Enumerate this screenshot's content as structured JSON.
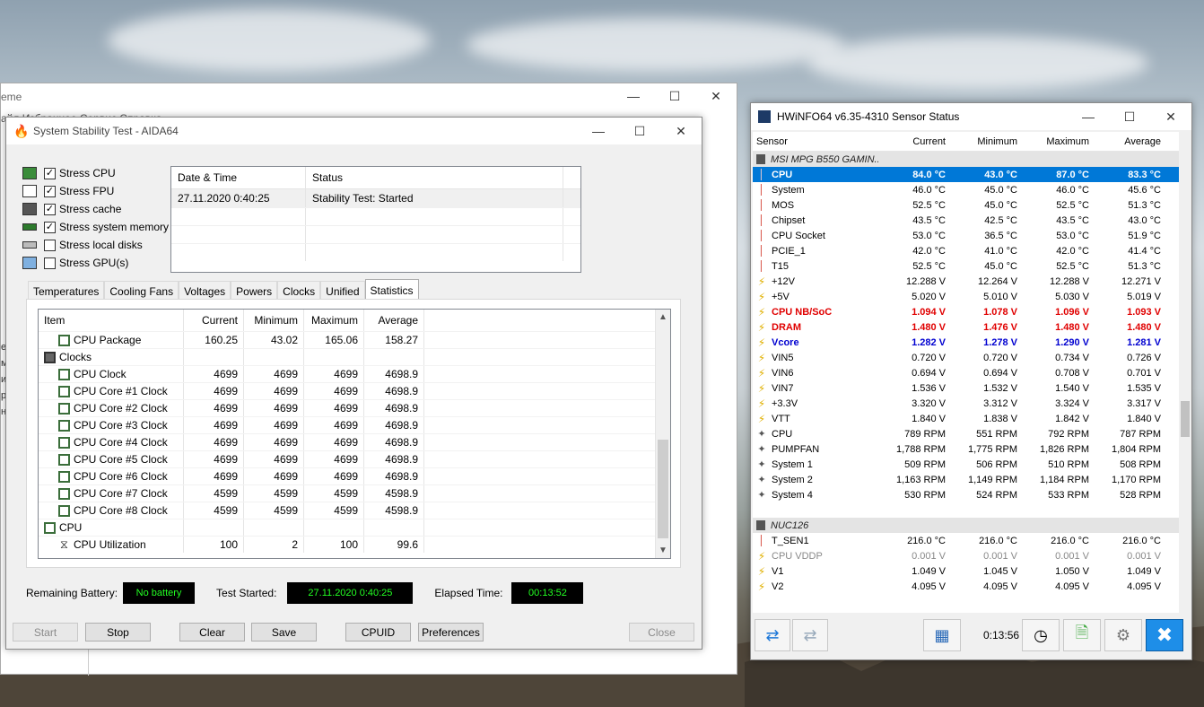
{
  "bg_window": {
    "title": "eme",
    "menu": "айл  Избранное  Сервис  Справка",
    "left_glyphs": [
      "е",
      "м",
      "и",
      "р",
      "н"
    ]
  },
  "aida": {
    "title": "System Stability Test - AIDA64",
    "stress": [
      {
        "label": "Stress CPU",
        "checked": true,
        "icon": "cpu-icon"
      },
      {
        "label": "Stress FPU",
        "checked": true,
        "icon": "fpu-icon"
      },
      {
        "label": "Stress cache",
        "checked": true,
        "icon": "cache-icon"
      },
      {
        "label": "Stress system memory",
        "checked": true,
        "icon": "memory-icon"
      },
      {
        "label": "Stress local disks",
        "checked": false,
        "icon": "disk-icon"
      },
      {
        "label": "Stress GPU(s)",
        "checked": false,
        "icon": "gpu-icon"
      }
    ],
    "status": {
      "headers": [
        "Date & Time",
        "Status"
      ],
      "rows": [
        [
          "27.11.2020 0:40:25",
          "Stability Test: Started"
        ]
      ]
    },
    "tabs": [
      "Temperatures",
      "Cooling Fans",
      "Voltages",
      "Powers",
      "Clocks",
      "Unified",
      "Statistics"
    ],
    "active_tab": "Statistics",
    "stats_headers": [
      "Item",
      "Current",
      "Minimum",
      "Maximum",
      "Average"
    ],
    "stats_rows": [
      {
        "name": "CPU Package",
        "level": 1,
        "icon": "chip",
        "cur": "160.25",
        "min": "43.02",
        "max": "165.06",
        "avg": "158.27"
      },
      {
        "name": "Clocks",
        "level": 0,
        "icon": "dark",
        "cur": "",
        "min": "",
        "max": "",
        "avg": ""
      },
      {
        "name": "CPU Clock",
        "level": 1,
        "icon": "chip",
        "cur": "4699",
        "min": "4699",
        "max": "4699",
        "avg": "4698.9"
      },
      {
        "name": "CPU Core #1 Clock",
        "level": 1,
        "icon": "chip",
        "cur": "4699",
        "min": "4699",
        "max": "4699",
        "avg": "4698.9"
      },
      {
        "name": "CPU Core #2 Clock",
        "level": 1,
        "icon": "chip",
        "cur": "4699",
        "min": "4699",
        "max": "4699",
        "avg": "4698.9"
      },
      {
        "name": "CPU Core #3 Clock",
        "level": 1,
        "icon": "chip",
        "cur": "4699",
        "min": "4699",
        "max": "4699",
        "avg": "4698.9"
      },
      {
        "name": "CPU Core #4 Clock",
        "level": 1,
        "icon": "chip",
        "cur": "4699",
        "min": "4699",
        "max": "4699",
        "avg": "4698.9"
      },
      {
        "name": "CPU Core #5 Clock",
        "level": 1,
        "icon": "chip",
        "cur": "4699",
        "min": "4699",
        "max": "4699",
        "avg": "4698.9"
      },
      {
        "name": "CPU Core #6 Clock",
        "level": 1,
        "icon": "chip",
        "cur": "4699",
        "min": "4699",
        "max": "4699",
        "avg": "4698.9"
      },
      {
        "name": "CPU Core #7 Clock",
        "level": 1,
        "icon": "chip",
        "cur": "4599",
        "min": "4599",
        "max": "4599",
        "avg": "4598.9"
      },
      {
        "name": "CPU Core #8 Clock",
        "level": 1,
        "icon": "chip",
        "cur": "4599",
        "min": "4599",
        "max": "4599",
        "avg": "4598.9"
      },
      {
        "name": "CPU",
        "level": 0,
        "icon": "chip",
        "cur": "",
        "min": "",
        "max": "",
        "avg": ""
      },
      {
        "name": "CPU Utilization",
        "level": 1,
        "icon": "hourglass",
        "cur": "100",
        "min": "2",
        "max": "100",
        "avg": "99.6"
      }
    ],
    "info": {
      "battery_label": "Remaining Battery:",
      "battery_value": "No battery",
      "started_label": "Test Started:",
      "started_value": "27.11.2020 0:40:25",
      "elapsed_label": "Elapsed Time:",
      "elapsed_value": "00:13:52"
    },
    "buttons": {
      "start": "Start",
      "stop": "Stop",
      "clear": "Clear",
      "save": "Save",
      "cpuid": "CPUID",
      "preferences": "Preferences",
      "close": "Close"
    }
  },
  "hwinfo": {
    "title": "HWiNFO64 v6.35-4310 Sensor Status",
    "headers": [
      "Sensor",
      "Current",
      "Minimum",
      "Maximum",
      "Average"
    ],
    "rows": [
      {
        "type": "group",
        "name": "MSI MPG B550 GAMIN..."
      },
      {
        "type": "therm",
        "style": "sel",
        "name": "CPU",
        "cur": "84.0 °C",
        "min": "43.0 °C",
        "max": "87.0 °C",
        "avg": "83.3 °C"
      },
      {
        "type": "therm",
        "name": "System",
        "cur": "46.0 °C",
        "min": "45.0 °C",
        "max": "46.0 °C",
        "avg": "45.6 °C"
      },
      {
        "type": "therm",
        "name": "MOS",
        "cur": "52.5 °C",
        "min": "45.0 °C",
        "max": "52.5 °C",
        "avg": "51.3 °C"
      },
      {
        "type": "therm",
        "name": "Chipset",
        "cur": "43.5 °C",
        "min": "42.5 °C",
        "max": "43.5 °C",
        "avg": "43.0 °C"
      },
      {
        "type": "therm",
        "name": "CPU Socket",
        "cur": "53.0 °C",
        "min": "36.5 °C",
        "max": "53.0 °C",
        "avg": "51.9 °C"
      },
      {
        "type": "therm",
        "name": "PCIE_1",
        "cur": "42.0 °C",
        "min": "41.0 °C",
        "max": "42.0 °C",
        "avg": "41.4 °C"
      },
      {
        "type": "therm",
        "name": "T15",
        "cur": "52.5 °C",
        "min": "45.0 °C",
        "max": "52.5 °C",
        "avg": "51.3 °C"
      },
      {
        "type": "bolt",
        "name": "+12V",
        "cur": "12.288 V",
        "min": "12.264 V",
        "max": "12.288 V",
        "avg": "12.271 V"
      },
      {
        "type": "bolt",
        "name": "+5V",
        "cur": "5.020 V",
        "min": "5.010 V",
        "max": "5.030 V",
        "avg": "5.019 V"
      },
      {
        "type": "bolt",
        "style": "red",
        "name": "CPU NB/SoC",
        "cur": "1.094 V",
        "min": "1.078 V",
        "max": "1.096 V",
        "avg": "1.093 V"
      },
      {
        "type": "bolt",
        "style": "red",
        "name": "DRAM",
        "cur": "1.480 V",
        "min": "1.476 V",
        "max": "1.480 V",
        "avg": "1.480 V"
      },
      {
        "type": "bolt",
        "style": "blue",
        "name": "Vcore",
        "cur": "1.282 V",
        "min": "1.278 V",
        "max": "1.290 V",
        "avg": "1.281 V"
      },
      {
        "type": "bolt",
        "name": "VIN5",
        "cur": "0.720 V",
        "min": "0.720 V",
        "max": "0.734 V",
        "avg": "0.726 V"
      },
      {
        "type": "bolt",
        "name": "VIN6",
        "cur": "0.694 V",
        "min": "0.694 V",
        "max": "0.708 V",
        "avg": "0.701 V"
      },
      {
        "type": "bolt",
        "name": "VIN7",
        "cur": "1.536 V",
        "min": "1.532 V",
        "max": "1.540 V",
        "avg": "1.535 V"
      },
      {
        "type": "bolt",
        "name": "+3.3V",
        "cur": "3.320 V",
        "min": "3.312 V",
        "max": "3.324 V",
        "avg": "3.317 V"
      },
      {
        "type": "bolt",
        "name": "VTT",
        "cur": "1.840 V",
        "min": "1.838 V",
        "max": "1.842 V",
        "avg": "1.840 V"
      },
      {
        "type": "fan",
        "name": "CPU",
        "cur": "789 RPM",
        "min": "551 RPM",
        "max": "792 RPM",
        "avg": "787 RPM"
      },
      {
        "type": "fan",
        "name": "PUMPFAN",
        "cur": "1,788 RPM",
        "min": "1,775 RPM",
        "max": "1,826 RPM",
        "avg": "1,804 RPM"
      },
      {
        "type": "fan",
        "name": "System 1",
        "cur": "509 RPM",
        "min": "506 RPM",
        "max": "510 RPM",
        "avg": "508 RPM"
      },
      {
        "type": "fan",
        "name": "System 2",
        "cur": "1,163 RPM",
        "min": "1,149 RPM",
        "max": "1,184 RPM",
        "avg": "1,170 RPM"
      },
      {
        "type": "fan",
        "name": "System 4",
        "cur": "530 RPM",
        "min": "524 RPM",
        "max": "533 RPM",
        "avg": "528 RPM"
      },
      {
        "type": "blank"
      },
      {
        "type": "group",
        "name": "NUC126"
      },
      {
        "type": "therm",
        "name": "T_SEN1",
        "cur": "216.0 °C",
        "min": "216.0 °C",
        "max": "216.0 °C",
        "avg": "216.0 °C"
      },
      {
        "type": "bolt",
        "style": "dim",
        "name": "CPU VDDP",
        "cur": "0.001 V",
        "min": "0.001 V",
        "max": "0.001 V",
        "avg": "0.001 V"
      },
      {
        "type": "bolt",
        "name": "V1",
        "cur": "1.049 V",
        "min": "1.045 V",
        "max": "1.050 V",
        "avg": "1.049 V"
      },
      {
        "type": "bolt",
        "name": "V2",
        "cur": "4.095 V",
        "min": "4.095 V",
        "max": "4.095 V",
        "avg": "4.095 V"
      }
    ],
    "elapsed": "0:13:56"
  }
}
